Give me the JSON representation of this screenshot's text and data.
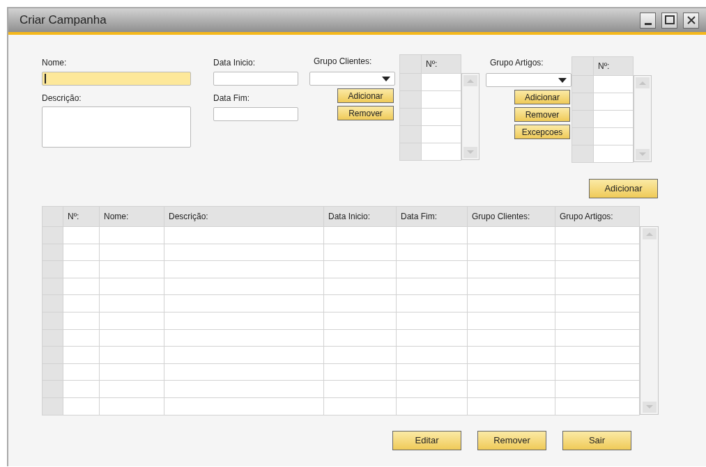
{
  "window": {
    "title": "Criar Campanha"
  },
  "name_field": {
    "label": "Nome:",
    "focused": true
  },
  "description_field": {
    "label": "Descrição:",
    "focused": false
  },
  "start_date_field": {
    "label": "Data Inicio:",
    "focused": false
  },
  "end_date_field": {
    "label": "Data Fim:",
    "focused": false
  },
  "customer_groups": {
    "label": "Grupo Clientes:",
    "buttons": [
      "Adicionar",
      "Remover"
    ],
    "grid": {
      "columns": [
        "Nº:"
      ]
    }
  },
  "item_groups": {
    "label": "Grupo Artigos:",
    "buttons": [
      "Adicionar",
      "Remover",
      "Excepcoes"
    ],
    "grid": {
      "columns": [
        "Nº:"
      ]
    }
  },
  "add_button": "Adicionar",
  "table": {
    "columns": [
      "Nº:",
      "Nome:",
      "Descrição:",
      "Data Inicio:",
      "Data Fim:",
      "Grupo Clientes:",
      "Grupo Artigos:"
    ]
  },
  "buttons": [
    "Editar",
    "Remover",
    "Sair"
  ]
}
